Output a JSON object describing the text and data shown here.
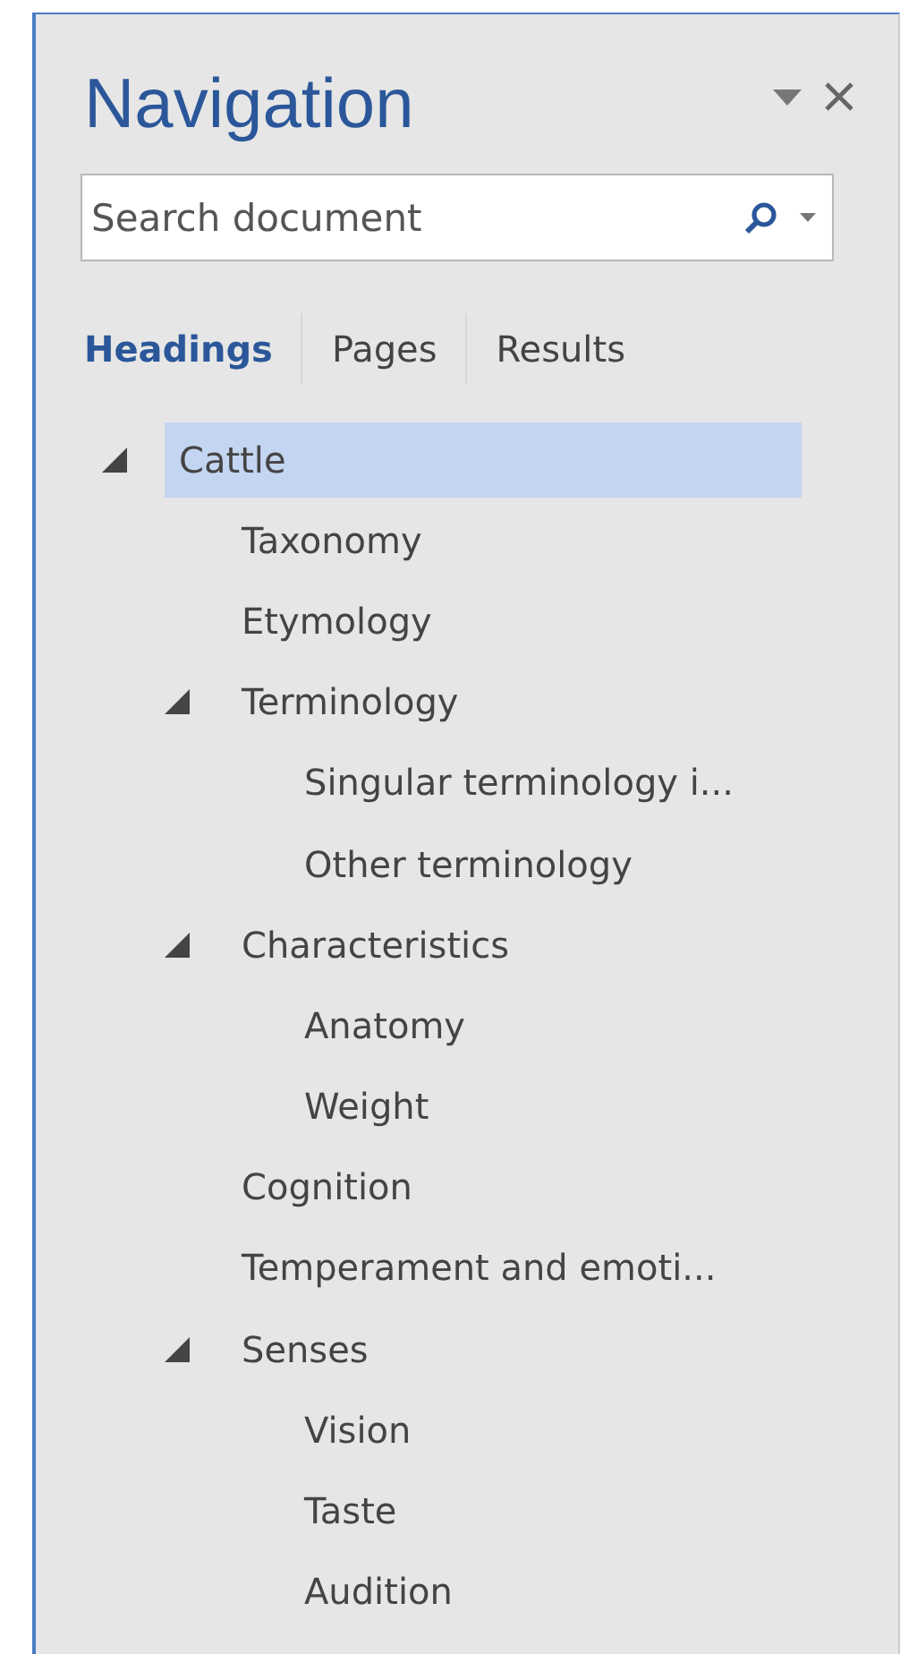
{
  "pane": {
    "title": "Navigation"
  },
  "search": {
    "placeholder": "Search document"
  },
  "tabs": [
    {
      "label": "Headings",
      "selected": true
    },
    {
      "label": "Pages",
      "selected": false
    },
    {
      "label": "Results",
      "selected": false
    }
  ],
  "tree": [
    {
      "label": "Cattle",
      "selected": true,
      "expanded": true,
      "children": [
        {
          "label": "Taxonomy",
          "selected": false
        },
        {
          "label": "Etymology",
          "selected": false
        },
        {
          "label": "Terminology",
          "selected": false,
          "expanded": true,
          "children": [
            {
              "label": "Singular terminology i...",
              "selected": false
            },
            {
              "label": "Other terminology",
              "selected": false
            }
          ]
        },
        {
          "label": "Characteristics",
          "selected": false,
          "expanded": true,
          "children": [
            {
              "label": "Anatomy",
              "selected": false
            },
            {
              "label": "Weight",
              "selected": false
            }
          ]
        },
        {
          "label": "Cognition",
          "selected": false
        },
        {
          "label": "Temperament and emoti...",
          "selected": false
        },
        {
          "label": "Senses",
          "selected": false,
          "expanded": true,
          "children": [
            {
              "label": "Vision",
              "selected": false
            },
            {
              "label": "Taste",
              "selected": false
            },
            {
              "label": "Audition",
              "selected": false
            }
          ]
        }
      ]
    }
  ]
}
